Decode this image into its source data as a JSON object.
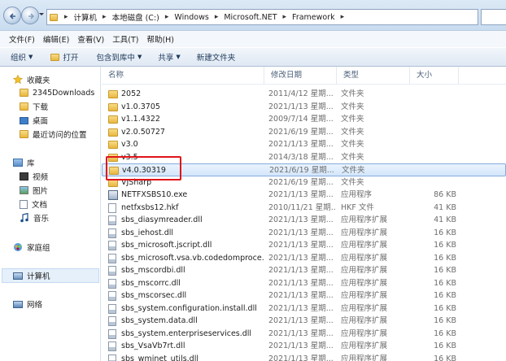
{
  "address": {
    "crumbs": [
      "计算机",
      "本地磁盘 (C:)",
      "Windows",
      "Microsoft.NET",
      "Framework"
    ]
  },
  "menu": [
    "文件(F)",
    "编辑(E)",
    "查看(V)",
    "工具(T)",
    "帮助(H)"
  ],
  "toolbar": {
    "organize": "组织",
    "open": "打开",
    "include_in_library": "包含到库中",
    "share": "共享",
    "new_folder": "新建文件夹"
  },
  "nav": {
    "favorites": "收藏夹",
    "downloads2345": "2345Downloads",
    "downloads": "下载",
    "desktop": "桌面",
    "recent": "最近访问的位置",
    "libraries": "库",
    "videos": "视频",
    "pictures": "图片",
    "documents": "文档",
    "music": "音乐",
    "homegroup": "家庭组",
    "computer": "计算机",
    "network": "网络"
  },
  "columns": {
    "name": "名称",
    "date": "修改日期",
    "type": "类型",
    "size": "大小"
  },
  "files": [
    {
      "name": "2052",
      "date": "2011/4/12 星期...",
      "type": "文件夹",
      "size": "",
      "kind": "folder"
    },
    {
      "name": "v1.0.3705",
      "date": "2021/1/13 星期...",
      "type": "文件夹",
      "size": "",
      "kind": "folder"
    },
    {
      "name": "v1.1.4322",
      "date": "2009/7/14 星期...",
      "type": "文件夹",
      "size": "",
      "kind": "folder"
    },
    {
      "name": "v2.0.50727",
      "date": "2021/6/19 星期...",
      "type": "文件夹",
      "size": "",
      "kind": "folder"
    },
    {
      "name": "v3.0",
      "date": "2021/1/13 星期...",
      "type": "文件夹",
      "size": "",
      "kind": "folder"
    },
    {
      "name": "v3.5",
      "date": "2014/3/18 星期...",
      "type": "文件夹",
      "size": "",
      "kind": "folder"
    },
    {
      "name": "v4.0.30319",
      "date": "2021/6/19 星期...",
      "type": "文件夹",
      "size": "",
      "kind": "folder",
      "selected": true
    },
    {
      "name": "VJSharp",
      "date": "2021/6/19 星期...",
      "type": "文件夹",
      "size": "",
      "kind": "folder"
    },
    {
      "name": "NETFXSBS10.exe",
      "date": "2021/1/13 星期...",
      "type": "应用程序",
      "size": "86 KB",
      "kind": "exe"
    },
    {
      "name": "netfxsbs12.hkf",
      "date": "2010/11/21 星期...",
      "type": "HKF 文件",
      "size": "41 KB",
      "kind": "file"
    },
    {
      "name": "sbs_diasymreader.dll",
      "date": "2021/1/13 星期...",
      "type": "应用程序扩展",
      "size": "41 KB",
      "kind": "dll"
    },
    {
      "name": "sbs_iehost.dll",
      "date": "2021/1/13 星期...",
      "type": "应用程序扩展",
      "size": "16 KB",
      "kind": "dll"
    },
    {
      "name": "sbs_microsoft.jscript.dll",
      "date": "2021/1/13 星期...",
      "type": "应用程序扩展",
      "size": "16 KB",
      "kind": "dll"
    },
    {
      "name": "sbs_microsoft.vsa.vb.codedomproce...",
      "date": "2021/1/13 星期...",
      "type": "应用程序扩展",
      "size": "16 KB",
      "kind": "dll"
    },
    {
      "name": "sbs_mscordbi.dll",
      "date": "2021/1/13 星期...",
      "type": "应用程序扩展",
      "size": "16 KB",
      "kind": "dll"
    },
    {
      "name": "sbs_mscorrc.dll",
      "date": "2021/1/13 星期...",
      "type": "应用程序扩展",
      "size": "16 KB",
      "kind": "dll"
    },
    {
      "name": "sbs_mscorsec.dll",
      "date": "2021/1/13 星期...",
      "type": "应用程序扩展",
      "size": "16 KB",
      "kind": "dll"
    },
    {
      "name": "sbs_system.configuration.install.dll",
      "date": "2021/1/13 星期...",
      "type": "应用程序扩展",
      "size": "16 KB",
      "kind": "dll"
    },
    {
      "name": "sbs_system.data.dll",
      "date": "2021/1/13 星期...",
      "type": "应用程序扩展",
      "size": "16 KB",
      "kind": "dll"
    },
    {
      "name": "sbs_system.enterpriseservices.dll",
      "date": "2021/1/13 星期...",
      "type": "应用程序扩展",
      "size": "16 KB",
      "kind": "dll"
    },
    {
      "name": "sbs_VsaVb7rt.dll",
      "date": "2021/1/13 星期...",
      "type": "应用程序扩展",
      "size": "16 KB",
      "kind": "dll"
    },
    {
      "name": "sbs_wminet_utils.dll",
      "date": "2021/1/13 星期...",
      "type": "应用程序扩展",
      "size": "16 KB",
      "kind": "dll"
    }
  ],
  "colors": {
    "highlight_box": "#e0141b",
    "selection": "#d4e6fb"
  }
}
